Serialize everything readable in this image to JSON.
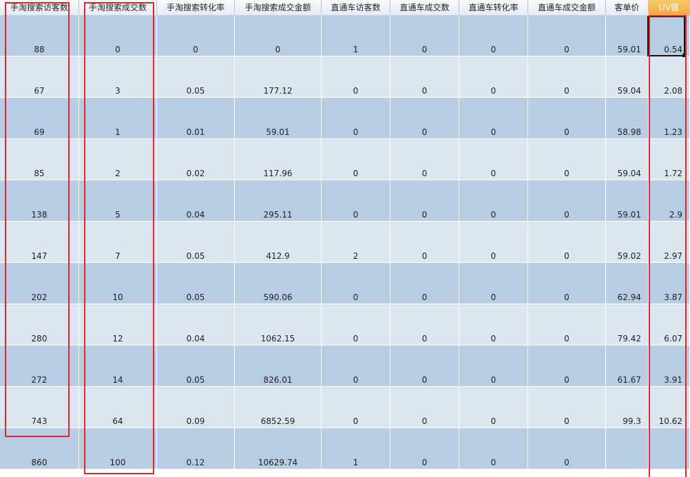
{
  "columns": [
    {
      "label": "手淘搜索访客数",
      "width": 115
    },
    {
      "label": "手淘搜索成交数",
      "width": 113
    },
    {
      "label": "手淘搜索转化率",
      "width": 113
    },
    {
      "label": "手淘搜索成交金额",
      "width": 126
    },
    {
      "label": "直通车访客数",
      "width": 100
    },
    {
      "label": "直通车成交数",
      "width": 100
    },
    {
      "label": "直通车转化率",
      "width": 100
    },
    {
      "label": "直通车成交金额",
      "width": 113
    },
    {
      "label": "客单价",
      "width": 62
    },
    {
      "label": "UV值",
      "width": 60
    }
  ],
  "rows": [
    [
      "88",
      "0",
      "0",
      "0",
      "1",
      "0",
      "0",
      "0",
      "59.01",
      "0.54"
    ],
    [
      "67",
      "3",
      "0.05",
      "177.12",
      "0",
      "0",
      "0",
      "0",
      "59.04",
      "2.08"
    ],
    [
      "69",
      "1",
      "0.01",
      "59.01",
      "0",
      "0",
      "0",
      "0",
      "58.98",
      "1.23"
    ],
    [
      "85",
      "2",
      "0.02",
      "117.96",
      "0",
      "0",
      "0",
      "0",
      "59.04",
      "1.72"
    ],
    [
      "138",
      "5",
      "0.04",
      "295.11",
      "0",
      "0",
      "0",
      "0",
      "59.01",
      "2.9"
    ],
    [
      "147",
      "7",
      "0.05",
      "412.9",
      "2",
      "0",
      "0",
      "0",
      "59.02",
      "2.97"
    ],
    [
      "202",
      "10",
      "0.05",
      "590.06",
      "0",
      "0",
      "0",
      "0",
      "62.94",
      "3.87"
    ],
    [
      "280",
      "12",
      "0.04",
      "1062.15",
      "0",
      "0",
      "0",
      "0",
      "79.42",
      "6.07"
    ],
    [
      "272",
      "14",
      "0.05",
      "826.01",
      "0",
      "0",
      "0",
      "0",
      "61.67",
      "3.91"
    ],
    [
      "743",
      "64",
      "0.09",
      "6852.59",
      "0",
      "0",
      "0",
      "0",
      "99.3",
      "10.62"
    ],
    [
      "860",
      "100",
      "0.12",
      "10629.74",
      "1",
      "0",
      "0",
      "0",
      "",
      ""
    ]
  ],
  "colors": {
    "dark_row": "#b8cce4",
    "light_row": "#dce6f1",
    "highlight_box": "#e4262a",
    "active_header": "#f1a943"
  }
}
